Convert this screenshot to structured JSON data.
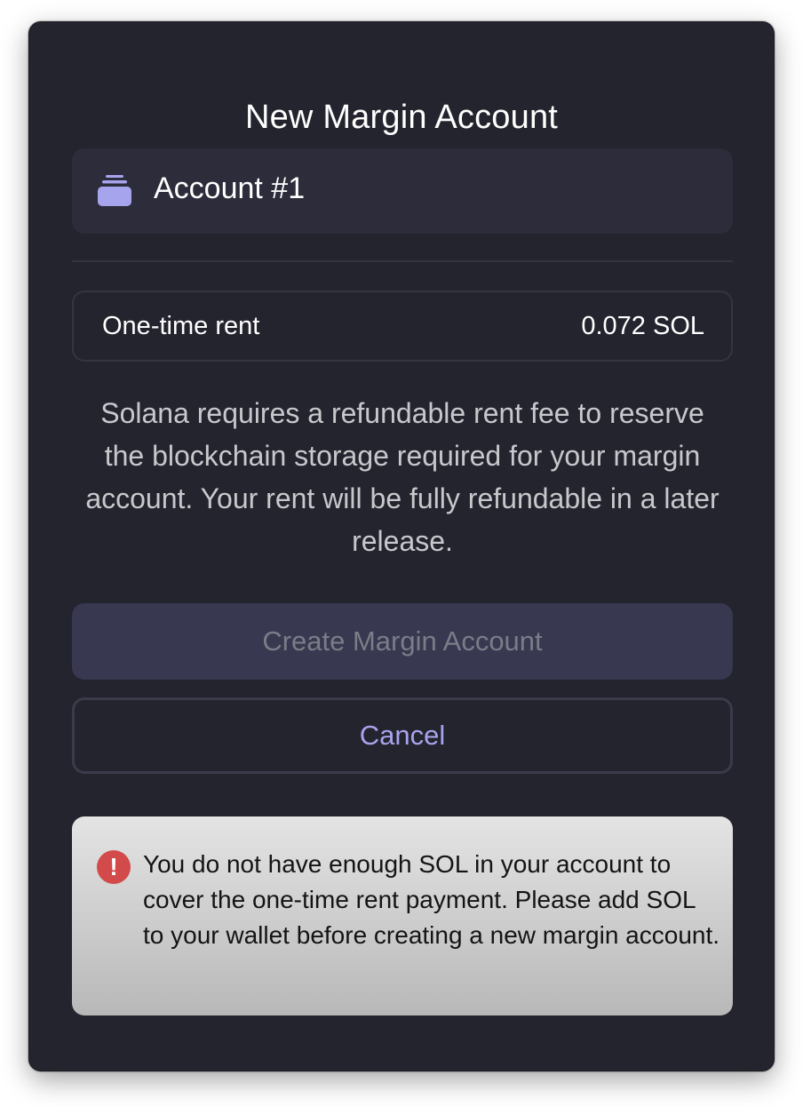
{
  "modal": {
    "title": "New Margin Account",
    "account": {
      "icon": "stacked-accounts-icon",
      "name": "Account #1"
    },
    "rent": {
      "label": "One-time rent",
      "value": "0.072 SOL"
    },
    "description": "Solana requires a refundable rent fee to reserve the blockchain storage required for your margin account. Your rent will be fully refundable in a later release.",
    "buttons": {
      "create_label": "Create Margin Account",
      "create_disabled": true,
      "cancel_label": "Cancel"
    },
    "warning": {
      "icon": "error-exclamation-icon",
      "text": "You do not have enough SOL in your account to cover the one-time rent payment. Please add SOL to your wallet before creating a new margin account."
    }
  },
  "colors": {
    "background": "#24242f",
    "accent": "#a9a3ec",
    "icon": "#a7a4ee",
    "error": "#d24a4a"
  }
}
